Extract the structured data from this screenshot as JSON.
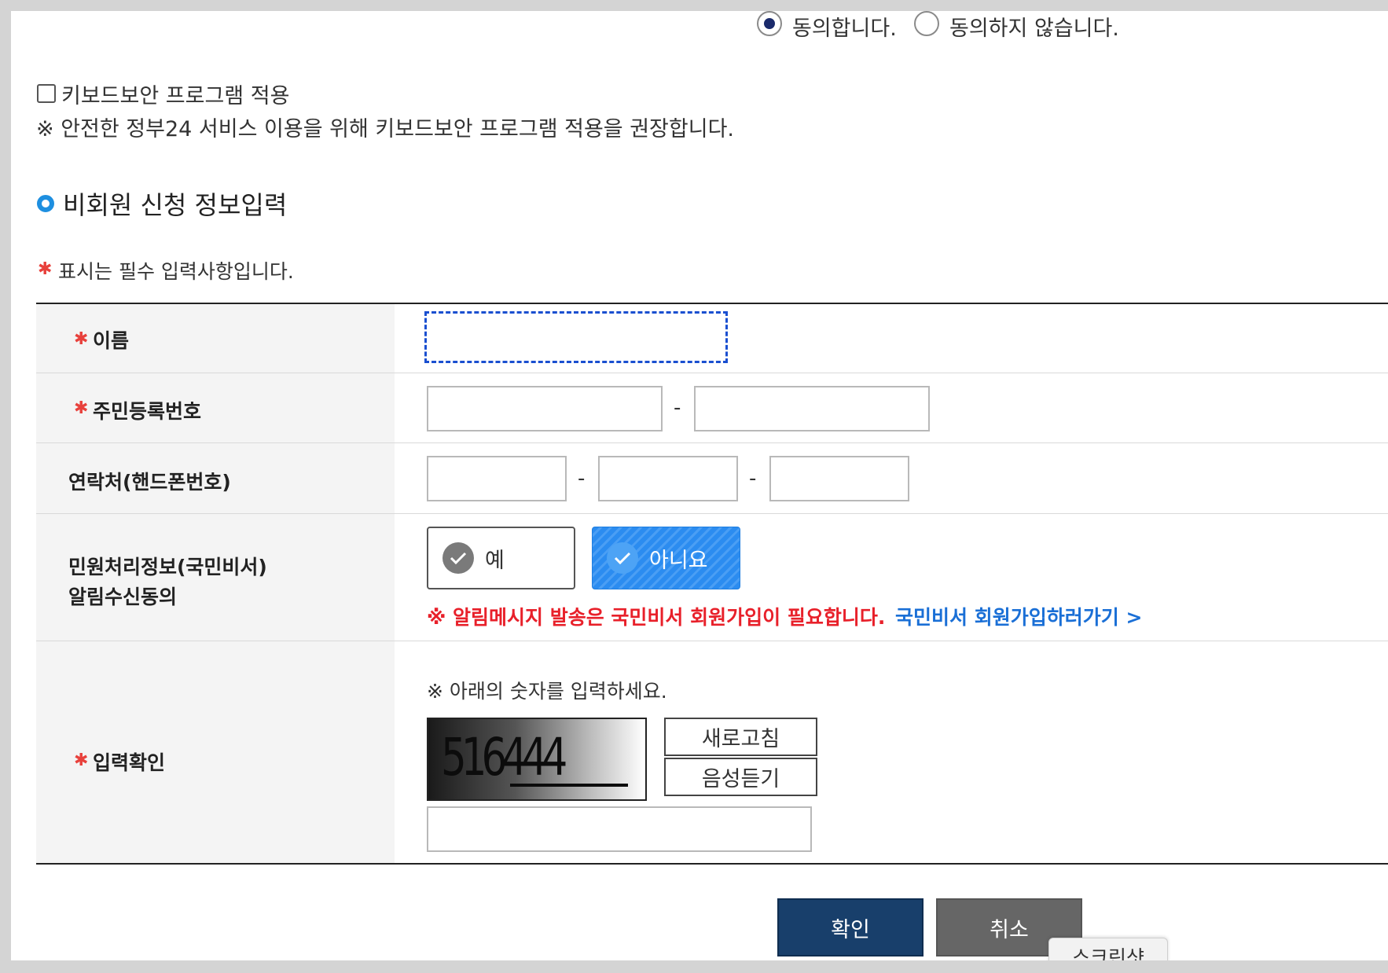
{
  "consent": {
    "agree_label": "동의합니다.",
    "disagree_label": "동의하지 않습니다."
  },
  "keyboard_security": {
    "label": "키보드보안 프로그램 적용",
    "notice": "※ 안전한 정부24 서비스 이용을 위해 키보드보안 프로그램 적용을 권장합니다."
  },
  "section": {
    "title": "비회원 신청 정보입력",
    "required_note": "표시는 필수 입력사항입니다."
  },
  "form": {
    "name_label": "이름",
    "rrn_label": "주민등록번호",
    "phone_label": "연락처(핸드폰번호)",
    "notice_label_line1": "민원처리정보(국민비서)",
    "notice_label_line2": "알림수신동의",
    "yes_label": "예",
    "no_label": "아니요",
    "warning_text": "※  알림메시지 발송은 국민비서 회원가입이 필요합니다.",
    "signup_link": "국민비서 회원가입하러가기 >",
    "captcha_label": "입력확인",
    "captcha_instruction": "※ 아래의 숫자를 입력하세요.",
    "captcha_value": "516444",
    "refresh_label": "새로고침",
    "audio_label": "음성듣기",
    "dash": "-"
  },
  "actions": {
    "confirm_label": "확인",
    "cancel_label": "취소"
  },
  "overlay": {
    "screenshot_label": "스크린샷"
  },
  "colors": {
    "primary_navy": "#183f6b",
    "cancel_gray": "#666666",
    "selected_blue": "#2b8cf0",
    "warning_red": "#e8202a",
    "link_blue": "#1a6fd6",
    "required_red": "#e8413c"
  }
}
